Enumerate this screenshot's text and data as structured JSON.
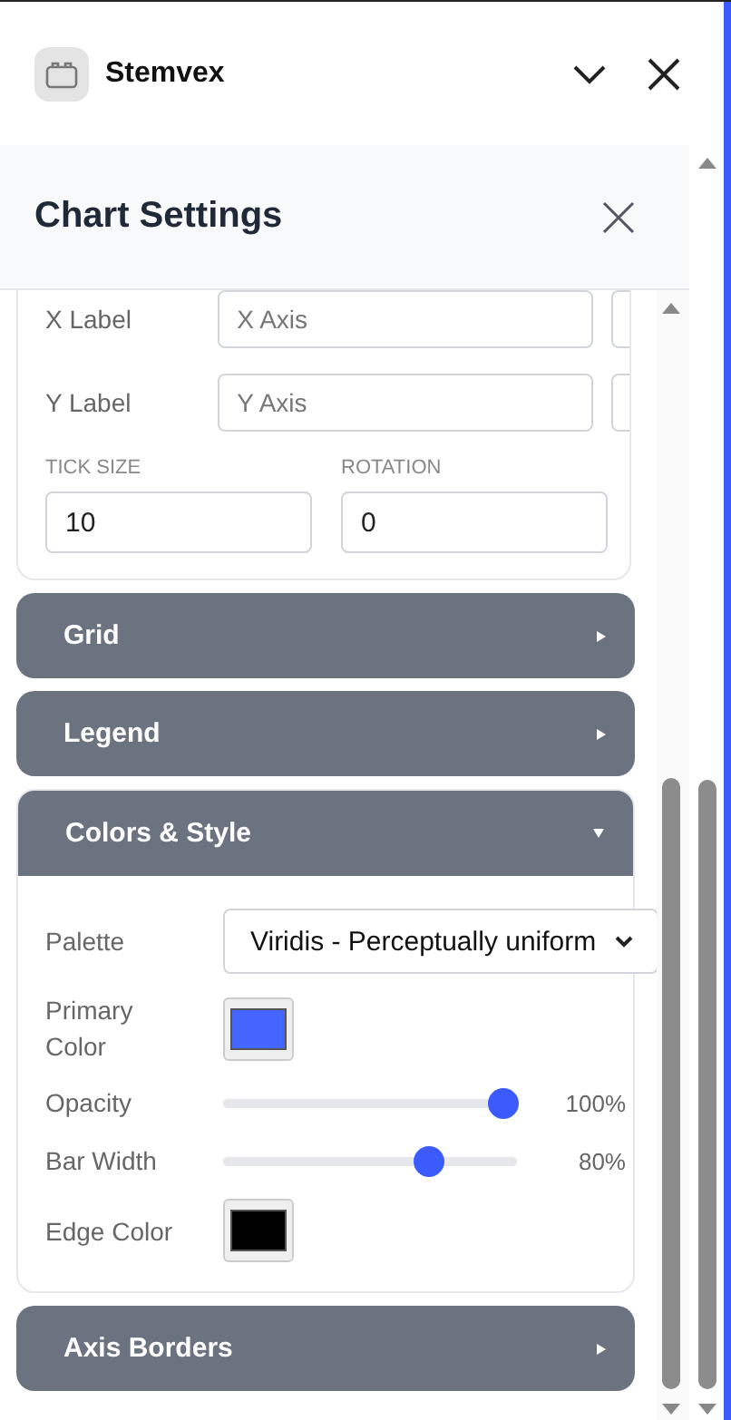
{
  "app": {
    "title": "Stemvex"
  },
  "panel": {
    "title": "Chart Settings"
  },
  "axis_labels": [
    {
      "label": "X Label",
      "placeholder": "X Axis"
    },
    {
      "label": "Y Label",
      "placeholder": "Y Axis"
    }
  ],
  "tick_fields": [
    {
      "label": "TICK SIZE",
      "value": "10"
    },
    {
      "label": "ROTATION",
      "value": "0"
    }
  ],
  "sections": [
    {
      "title": "Grid",
      "expanded": false
    },
    {
      "title": "Legend",
      "expanded": false
    },
    {
      "title": "Colors & Style",
      "expanded": true,
      "controls": [
        {
          "kind": "select",
          "label": "Palette",
          "value": "Viridis - Perceptually uniform"
        },
        {
          "kind": "color",
          "label": "Primary Color",
          "color": "#4466ff"
        },
        {
          "kind": "slider",
          "label": "Opacity",
          "level": 1,
          "reading": "100%"
        },
        {
          "kind": "slider",
          "label": "Bar Width",
          "level": 0.72,
          "reading": "80%"
        },
        {
          "kind": "color",
          "label": "Edge Color",
          "color": "#000000"
        }
      ]
    },
    {
      "title": "Axis Borders",
      "expanded": false
    }
  ]
}
